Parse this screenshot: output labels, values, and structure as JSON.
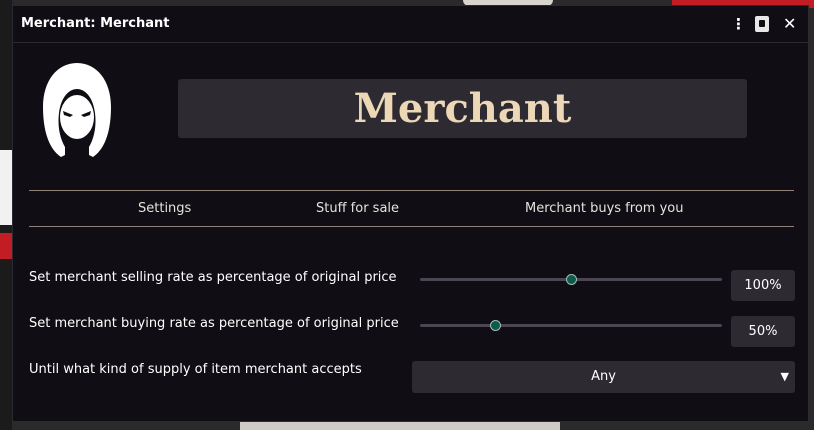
{
  "window": {
    "title": "Merchant: Merchant"
  },
  "header": {
    "name": "Merchant"
  },
  "tabs": [
    {
      "label": "Settings"
    },
    {
      "label": "Stuff for sale"
    },
    {
      "label": "Merchant buys from you"
    }
  ],
  "settings": {
    "selling_rate": {
      "label": "Set merchant selling rate as percentage of original price",
      "value_text": "100%",
      "slider_fraction": 0.5
    },
    "buying_rate": {
      "label": "Set merchant buying rate as percentage of original price",
      "value_text": "50%",
      "slider_fraction": 0.25
    },
    "supply": {
      "label": "Until what kind of supply of item merchant accepts",
      "selected": "Any"
    }
  },
  "colors": {
    "accent": "#ecd7b6",
    "panel": "#100d14",
    "control": "#2e2a32",
    "thumb": "#0f5a4c"
  },
  "icons": {
    "kebab": "kebab-menu-icon",
    "sheet": "sheet-icon",
    "close": "close-icon",
    "chevron": "chevron-down-icon"
  }
}
